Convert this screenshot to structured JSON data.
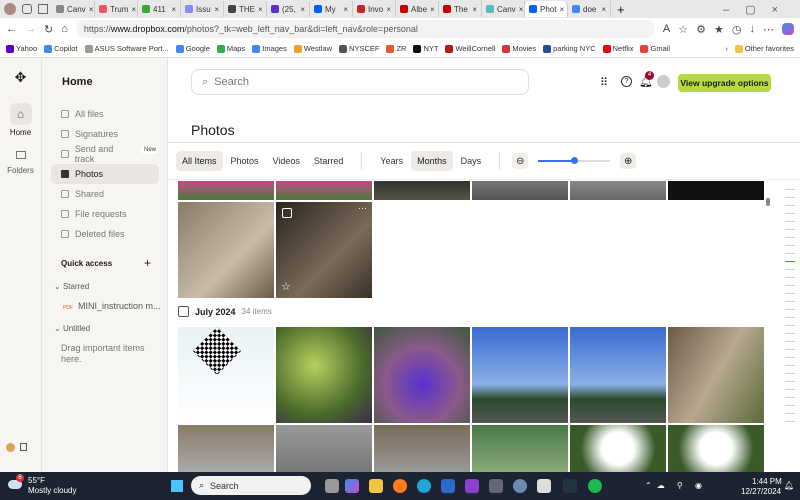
{
  "browser": {
    "tabs": [
      {
        "label": "Canv",
        "color": "#888"
      },
      {
        "label": "Trum",
        "color": "#e56"
      },
      {
        "label": "411",
        "color": "#3a3"
      },
      {
        "label": "Issu",
        "color": "#88f"
      },
      {
        "label": "THE",
        "color": "#444"
      },
      {
        "label": "(25,",
        "color": "#5a2fc4"
      },
      {
        "label": "My",
        "color": "#0061fe"
      },
      {
        "label": "Invo",
        "color": "#c22"
      },
      {
        "label": "Albe",
        "color": "#c00"
      },
      {
        "label": "The",
        "color": "#c00"
      },
      {
        "label": "Canv",
        "color": "#5bb"
      },
      {
        "label": "Phot",
        "color": "#0061fe",
        "active": true
      },
      {
        "label": "doe",
        "color": "#4285f4"
      }
    ],
    "url_prefix": "https://",
    "url_domain": "www.dropbox.com",
    "url_path": "/photos?_tk=web_left_nav_bar&di=left_nav&role=personal",
    "bookmarks": [
      {
        "label": "Yahoo",
        "color": "#5f01d1"
      },
      {
        "label": "Copilot",
        "color": "#3a8ee6"
      },
      {
        "label": "ASUS Software Port...",
        "color": "#999"
      },
      {
        "label": "Google",
        "color": "#4285f4"
      },
      {
        "label": "Maps",
        "color": "#34a853"
      },
      {
        "label": "Images",
        "color": "#4285f4"
      },
      {
        "label": "Westlaw",
        "color": "#f0a030"
      },
      {
        "label": "NYSCEF",
        "color": "#555"
      },
      {
        "label": "ZR",
        "color": "#e53"
      },
      {
        "label": "NYT",
        "color": "#111"
      },
      {
        "label": "WeillCornell",
        "color": "#b31b1b"
      },
      {
        "label": "Movies",
        "color": "#d33"
      },
      {
        "label": "parking NYC",
        "color": "#2a4a9a"
      },
      {
        "label": "Netflix",
        "color": "#e50914"
      },
      {
        "label": "Gmail",
        "color": "#ea4335"
      }
    ],
    "other_favorites": "Other favorites",
    "notif_count": "4"
  },
  "rail": {
    "home": "Home",
    "folders": "Folders"
  },
  "sidebar": {
    "title": "Home",
    "items": [
      {
        "label": "All files"
      },
      {
        "label": "Signatures"
      },
      {
        "label": "Send and track",
        "badge": "New"
      },
      {
        "label": "Photos",
        "selected": true
      },
      {
        "label": "Shared"
      },
      {
        "label": "File requests"
      },
      {
        "label": "Deleted files"
      }
    ],
    "quick_access": "Quick access",
    "starred": "Starred",
    "starred_file": "MINI_instruction m...",
    "pdf_tag": "PDF",
    "untitled": "Untitled",
    "drag_hint": "Drag important items here."
  },
  "header": {
    "search_placeholder": "Search",
    "notif_count": "4",
    "upgrade": "View upgrade options"
  },
  "page_title": "Photos",
  "filters": {
    "types": [
      "All Items",
      "Photos",
      "Videos",
      "Starred"
    ],
    "selected_type": "All Items",
    "periods": [
      "Years",
      "Months",
      "Days"
    ],
    "selected_period": "Months",
    "zoom": 0.5
  },
  "group": {
    "title": "July 2024",
    "count": "34 items"
  },
  "taskbar": {
    "temp": "55°F",
    "weather": "Mostly cloudy",
    "weather_badge": "6",
    "search": "Search",
    "time": "1:44 PM",
    "date": "12/27/2024"
  }
}
